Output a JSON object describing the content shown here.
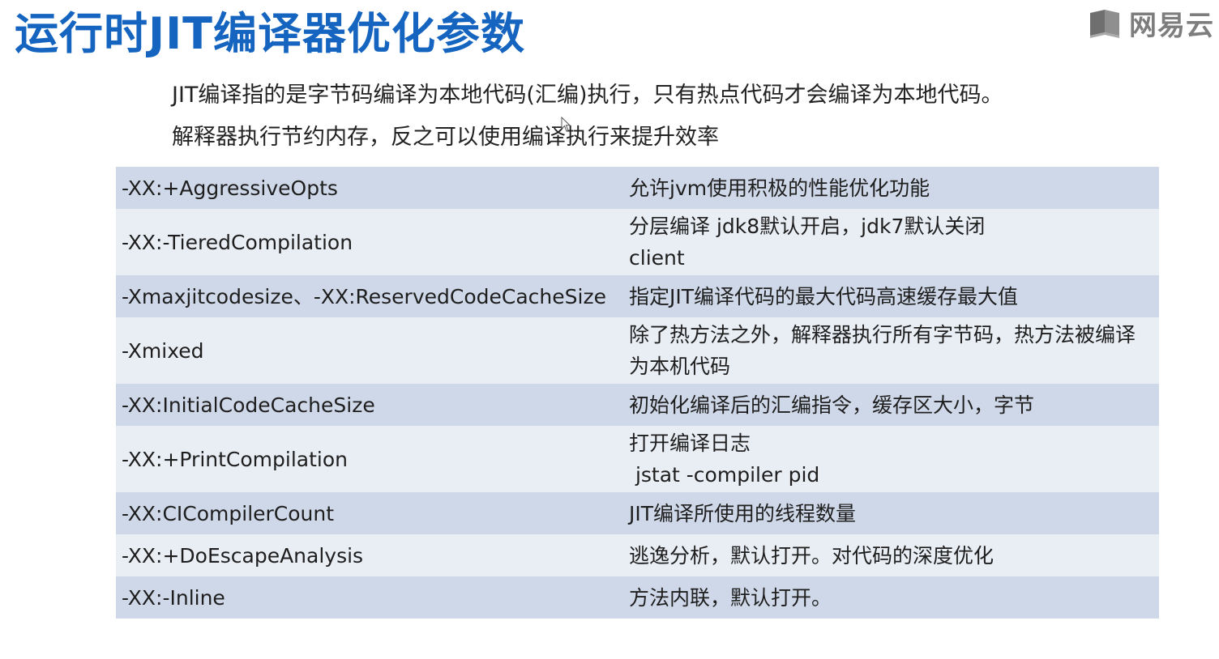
{
  "page": {
    "title": "运行时JIT编译器优化参数",
    "intro_line1": "JIT编译指的是字节码编译为本地代码(汇编)执行，只有热点代码才会编译为本地代码。",
    "intro_line2": "解释器执行节约内存，反之可以使用编译执行来提升效率"
  },
  "logo": {
    "text": "网易云",
    "icon": "book-icon"
  },
  "colors": {
    "title": "#1565c0",
    "row_dark": "#cfd8e8",
    "row_light": "#e9edf4"
  },
  "params_table": {
    "rows": [
      {
        "param": "-XX:+AggressiveOpts",
        "desc": [
          "允许jvm使用积极的性能优化功能"
        ]
      },
      {
        "param": "-XX:-TieredCompilation",
        "desc": [
          "分层编译 jdk8默认开启，jdk7默认关闭",
          "client"
        ]
      },
      {
        "param": "-Xmaxjitcodesize、-XX:ReservedCodeCacheSize",
        "desc": [
          "指定JIT编译代码的最大代码高速缓存最大值"
        ]
      },
      {
        "param": "-Xmixed",
        "desc": [
          "除了热方法之外，解释器执行所有字节码，热方法被编译",
          "为本机代码"
        ]
      },
      {
        "param": "-XX:InitialCodeCacheSize",
        "desc": [
          "初始化编译后的汇编指令，缓存区大小，字节"
        ]
      },
      {
        "param": "-XX:+PrintCompilation",
        "desc": [
          "打开编译日志",
          " jstat -compiler pid"
        ]
      },
      {
        "param": "-XX:CICompilerCount",
        "desc": [
          "JIT编译所使用的线程数量"
        ]
      },
      {
        "param": "-XX:+DoEscapeAnalysis",
        "desc": [
          "逃逸分析，默认打开。对代码的深度优化"
        ]
      },
      {
        "param": "-XX:-Inline",
        "desc": [
          "方法内联，默认打开。"
        ]
      }
    ]
  }
}
